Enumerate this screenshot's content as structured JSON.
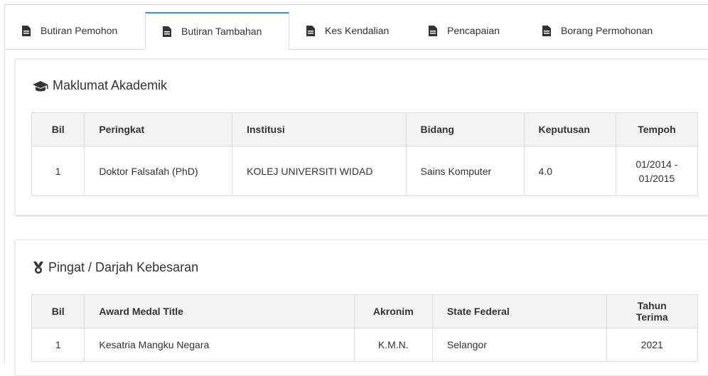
{
  "tabs": [
    {
      "label": "Butiran Pemohon",
      "icon": "document-icon"
    },
    {
      "label": "Butiran Tambahan",
      "icon": "document-icon",
      "active": true
    },
    {
      "label": "Kes Kendalian",
      "icon": "document-icon"
    },
    {
      "label": "Pencapaian",
      "icon": "document-icon"
    },
    {
      "label": "Borang Permohonan",
      "icon": "document-icon"
    }
  ],
  "academic": {
    "title": "Maklumat Akademik",
    "icon": "graduation-cap-icon",
    "headers": [
      "Bil",
      "Peringkat",
      "Institusi",
      "Bidang",
      "Keputusan",
      "Tempoh"
    ],
    "rows": [
      [
        "1",
        "Doktor Falsafah (PhD)",
        "KOLEJ UNIVERSITI WIDAD",
        "Sains Komputer",
        "4.0",
        "01/2014 -",
        "01/2015"
      ]
    ]
  },
  "medals": {
    "title": "Pingat / Darjah Kebesaran",
    "icon": "medal-icon",
    "headers": [
      "Bil",
      "Award Medal Title",
      "Akronim",
      "State Federal",
      "Tahun Terima"
    ],
    "rows": [
      [
        "1",
        "Kesatria Mangku Negara",
        "K.M.N.",
        "Selangor",
        "2021"
      ]
    ]
  },
  "colors": {
    "accent": "#2f96d8",
    "header_bg": "#f3f3f3",
    "border": "#dddddd"
  }
}
